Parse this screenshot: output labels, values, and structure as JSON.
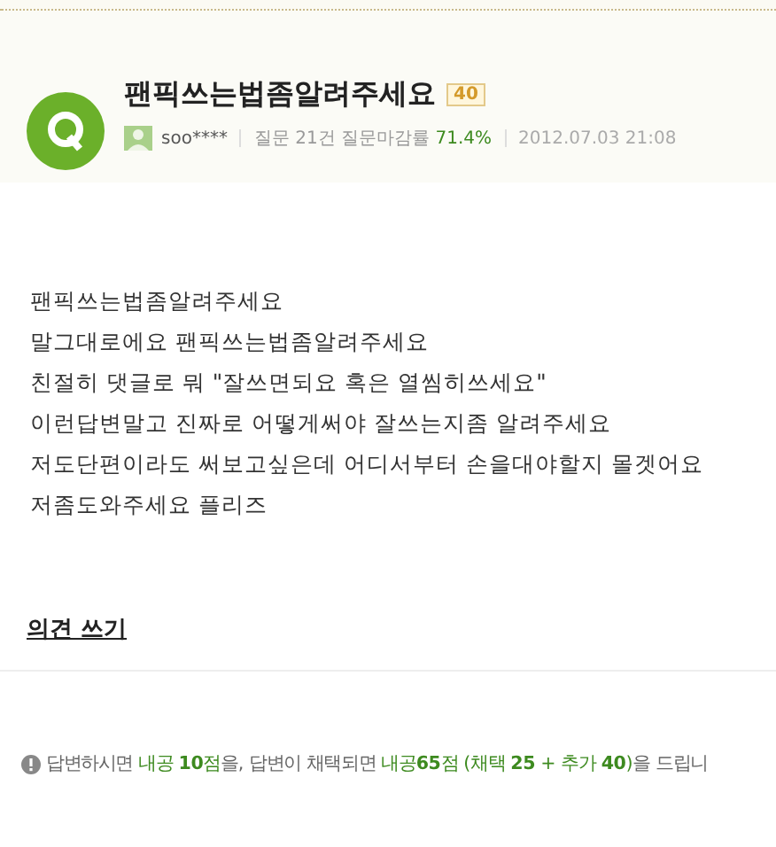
{
  "question": {
    "title": "팬픽쓰는법좀알려주세요",
    "points_badge": "40",
    "user": "soo****",
    "stats_label": "질문 21건 질문마감률",
    "stats_rate": "71.4%",
    "date": "2012.07.03 21:08"
  },
  "body_lines": [
    "팬픽쓰는법좀알려주세요",
    "말그대로에요 팬픽쓰는법좀알려주세요",
    "친절히 댓글로 뭐 \"잘쓰면되요 혹은 열씸히쓰세요\"",
    "이런답변말고 진짜로 어떻게써야 잘쓰는지좀 알려주세요",
    "저도단편이라도 써보고싶은데 어디서부터 손을대야할지 몰겟어요",
    "저좀도와주세요 플리즈"
  ],
  "comment_link": "의견 쓰기",
  "notice": [
    {
      "kind": "plain",
      "text": "답변하시면 "
    },
    {
      "kind": "green",
      "text": "내공 **10**점"
    },
    {
      "kind": "plain",
      "text": "을, 답변이 채택되면 "
    },
    {
      "kind": "green",
      "text": "내공**65**점 (채택 **25** + 추가 **40**)"
    },
    {
      "kind": "plain",
      "text": "을 드립니"
    }
  ]
}
